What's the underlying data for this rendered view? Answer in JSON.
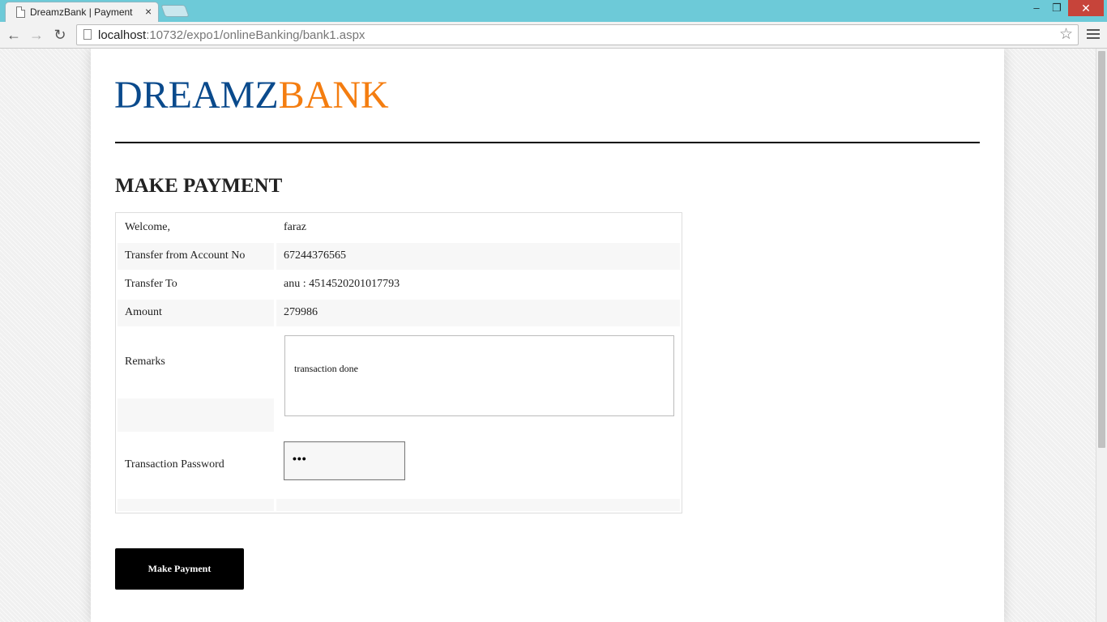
{
  "browser": {
    "tab_title": "DreamzBank | Payment",
    "tab_close": "×",
    "url_host": "localhost",
    "url_rest": ":10732/expo1/onlineBanking/bank1.aspx",
    "win_min": "–",
    "win_max": "❐",
    "win_close": "✕",
    "back": "←",
    "forward": "→",
    "reload": "↻",
    "star": "☆"
  },
  "header": {
    "logo_part1": "DREAMZ",
    "logo_part2": "BANK",
    "logo_color1": "#0a4a8c",
    "logo_color2": "#f47d10"
  },
  "main": {
    "heading": "MAKE PAYMENT",
    "rows": [
      {
        "label": "Welcome,",
        "value": "faraz"
      },
      {
        "label": "Transfer from Account No",
        "value": "67244376565"
      },
      {
        "label": "Transfer To",
        "value": "anu : 4514520201017793"
      },
      {
        "label": "Amount",
        "value": "279986"
      }
    ],
    "remarks_label": "Remarks",
    "remarks_value": "transaction done",
    "password_label": "Transaction Password",
    "password_value": "•••",
    "submit_label": "Make Payment"
  }
}
